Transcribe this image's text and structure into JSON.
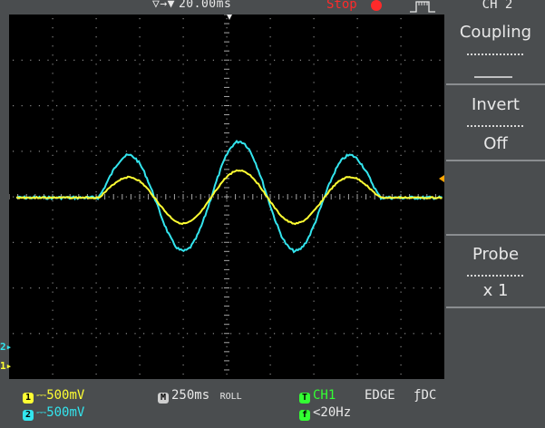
{
  "top": {
    "arrows": "▽→▼",
    "timebase_position": "20.00ms",
    "run_state": "Stop",
    "menu_title": "CH 2"
  },
  "menu": {
    "coupling_label": "Coupling",
    "invert_label": "Invert",
    "invert_value": "Off",
    "probe_label": "Probe",
    "probe_value": "x 1"
  },
  "markers": {
    "ch2": "2",
    "ch1": "1"
  },
  "status": {
    "ch1_badge": "1",
    "ch1_scale": "500mV",
    "ch2_badge": "2",
    "ch2_scale": "500mV",
    "timebase_badge": "M",
    "timebase_value": "250ms",
    "mode": "ROLL",
    "trigger_badge": "T",
    "trigger_source": "CH1",
    "trigger_type": "EDGE",
    "trigger_slope": "ƒ",
    "trigger_coupling": "DC",
    "freq_badge": "f",
    "frequency": "<20Hz"
  },
  "colors": {
    "ch1": "#ffff33",
    "ch2": "#33e5ee",
    "trigger": "#33ff33",
    "stop": "#ff2a2a"
  }
}
